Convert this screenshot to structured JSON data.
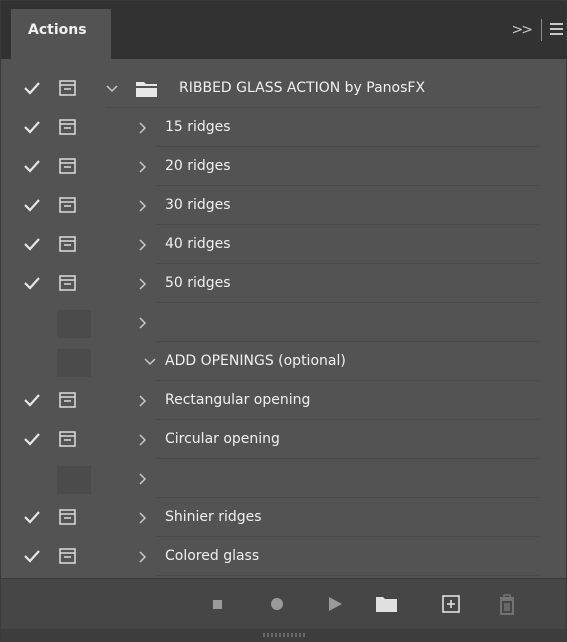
{
  "panel": {
    "tab_label": "Actions",
    "collapse_glyph": ">>",
    "menu_icon": "hamburger-menu-icon"
  },
  "actions": {
    "set": {
      "label": "RIBBED GLASS ACTION by PanosFX",
      "enabled": true,
      "dialog": true,
      "expanded": true,
      "icon": "folder-icon"
    },
    "items": [
      {
        "label": "15 ridges",
        "enabled": true,
        "dialog": true,
        "expanded": false
      },
      {
        "label": "20 ridges",
        "enabled": true,
        "dialog": true,
        "expanded": false
      },
      {
        "label": "30 ridges",
        "enabled": true,
        "dialog": true,
        "expanded": false
      },
      {
        "label": "40 ridges",
        "enabled": true,
        "dialog": true,
        "expanded": false
      },
      {
        "label": "50 ridges",
        "enabled": true,
        "dialog": true,
        "expanded": false
      },
      {
        "label": "",
        "enabled": false,
        "dialog": false,
        "expanded": false
      },
      {
        "label": "ADD OPENINGS (optional)",
        "enabled": false,
        "dialog": false,
        "expanded": true
      },
      {
        "label": "Rectangular opening",
        "enabled": true,
        "dialog": true,
        "expanded": false
      },
      {
        "label": "Circular opening",
        "enabled": true,
        "dialog": true,
        "expanded": false
      },
      {
        "label": "",
        "enabled": false,
        "dialog": false,
        "expanded": false
      },
      {
        "label": "Shinier ridges",
        "enabled": true,
        "dialog": true,
        "expanded": false
      },
      {
        "label": "Colored glass",
        "enabled": true,
        "dialog": true,
        "expanded": false
      }
    ]
  },
  "toolbar": {
    "buttons": [
      "stop-icon",
      "record-icon",
      "play-icon",
      "new-set-folder-icon",
      "new-action-icon",
      "delete-trash-icon"
    ]
  },
  "colors": {
    "panel_bg": "#535353",
    "tabbar_bg": "#323232",
    "text": "#f0f0f0",
    "icon": "#dcdcdc",
    "disabled_icon": "#9a9a9a"
  }
}
